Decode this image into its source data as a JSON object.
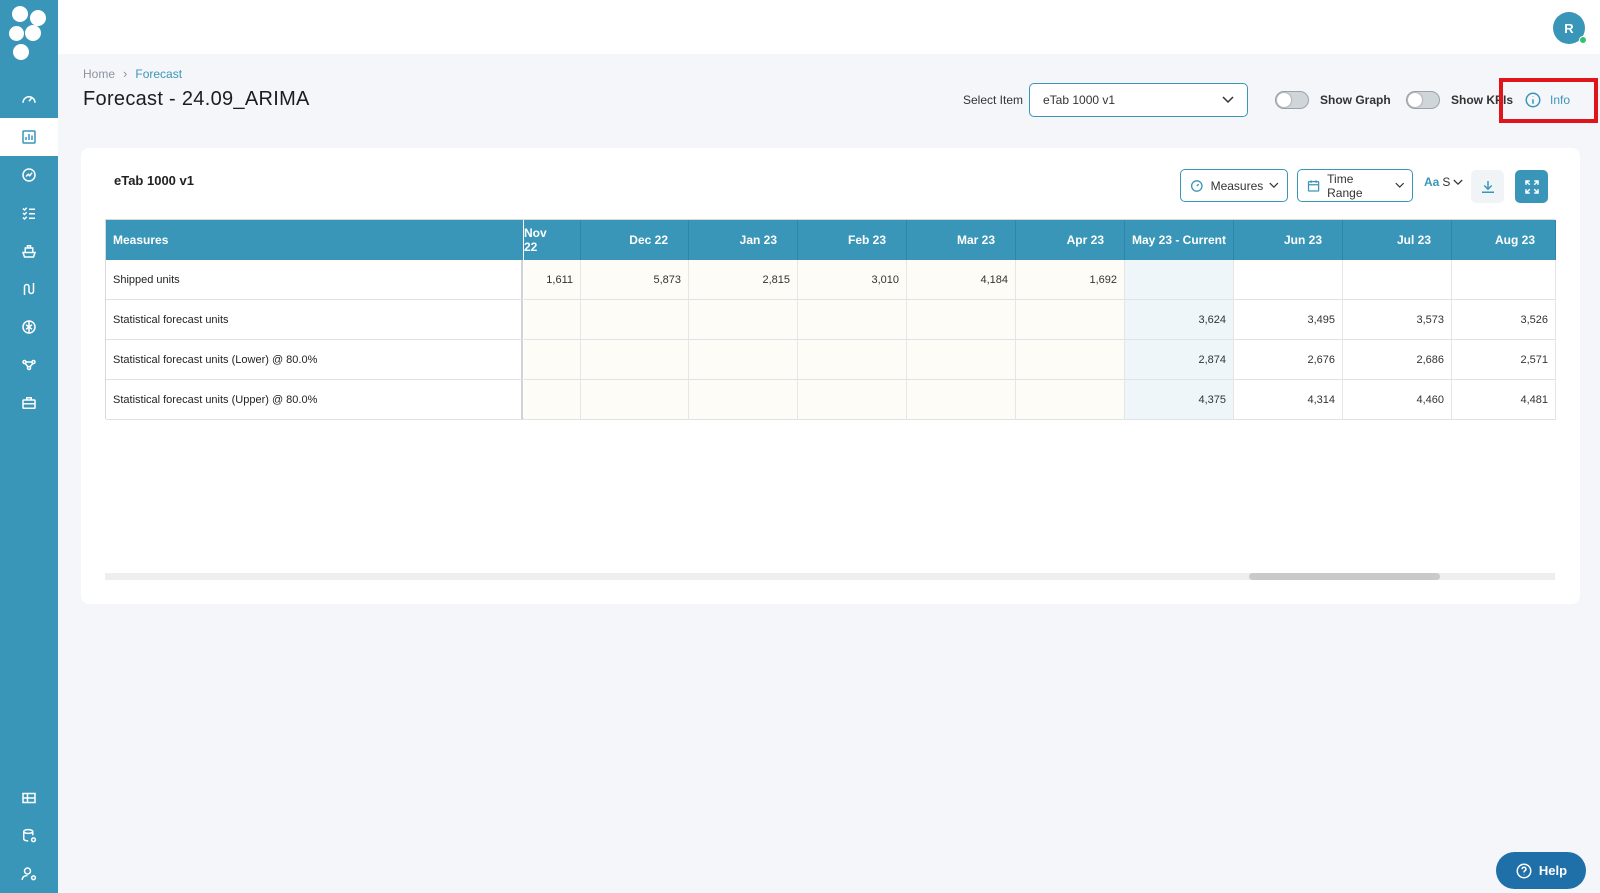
{
  "user": {
    "initial": "R"
  },
  "breadcrumb": {
    "home": "Home",
    "current": "Forecast"
  },
  "page_title": "Forecast - 24.09_ARIMA",
  "controls": {
    "select_item_label": "Select Item",
    "select_item_value": "eTab 1000 v1",
    "show_graph_label": "Show Graph",
    "show_kpis_label": "Show KPIs",
    "info_label": "Info"
  },
  "card": {
    "title": "eTab 1000 v1",
    "measures_button": "Measures",
    "time_range_button": "Time Range",
    "font_button": "S"
  },
  "table": {
    "measures_header": "Measures",
    "columns": [
      "Nov 22",
      "Dec 22",
      "Jan 23",
      "Feb 23",
      "Mar 23",
      "Apr 23",
      "May 23 - Current",
      "Jun 23",
      "Jul 23",
      "Aug 23"
    ],
    "rows": [
      {
        "label": "Shipped units",
        "values": [
          "1,611",
          "5,873",
          "2,815",
          "3,010",
          "4,184",
          "1,692",
          "",
          "",
          "",
          ""
        ]
      },
      {
        "label": "Statistical forecast units",
        "values": [
          "",
          "",
          "",
          "",
          "",
          "",
          "3,624",
          "3,495",
          "3,573",
          "3,526"
        ]
      },
      {
        "label": "Statistical forecast units (Lower) @  80.0%",
        "values": [
          "",
          "",
          "",
          "",
          "",
          "",
          "2,874",
          "2,676",
          "2,686",
          "2,571"
        ]
      },
      {
        "label": "Statistical forecast units (Upper) @  80.0%",
        "values": [
          "",
          "",
          "",
          "",
          "",
          "",
          "4,375",
          "4,314",
          "4,460",
          "4,481"
        ]
      }
    ]
  },
  "help_label": "Help",
  "colors": {
    "primary": "#3a96b8",
    "highlight": "#e0141b",
    "help": "#1f6fa8"
  }
}
